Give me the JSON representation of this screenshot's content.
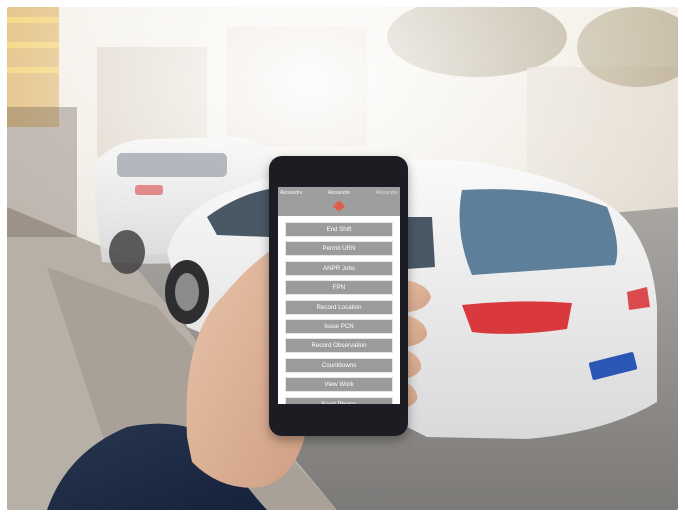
{
  "app": {
    "header": {
      "user_left": "Alexandre",
      "user_center": "Alexandre",
      "user_right": "Alexandre"
    },
    "logo_icon": "maple-leaf-icon",
    "menu_items": [
      "End Shift",
      "Permit URN",
      "ANPR Jobs",
      "FPN",
      "Record Location",
      "Issue PCN",
      "Record Observation",
      "Countdowns",
      "View Work",
      "Send Photos"
    ]
  },
  "colors": {
    "header_bg": "#9e9e9e",
    "button_bg": "#9b9b9b",
    "leaf": "#e25b4a",
    "phone_body": "#1c1d22",
    "car_white": "#f1f1f1",
    "taillight": "#d9393d",
    "plate_blue": "#2a57b5"
  }
}
